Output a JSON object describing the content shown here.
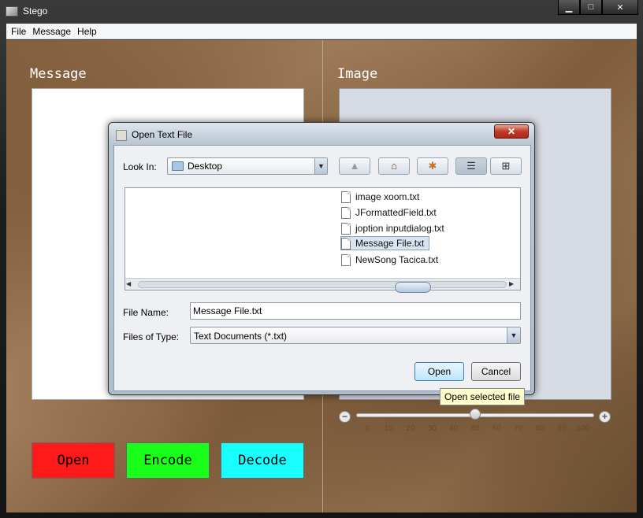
{
  "window": {
    "title": "Stego",
    "controls": {
      "minimize": "▁",
      "maximize": "□",
      "close": "✕"
    }
  },
  "menu": [
    "File",
    "Message",
    "Help"
  ],
  "panels": {
    "message_title": "Message",
    "image_title": "Image"
  },
  "buttons": {
    "open": "Open",
    "encode": "Encode",
    "decode": "Decode"
  },
  "button_colors": {
    "open": "#ff1a1a",
    "encode": "#1aff1a",
    "decode": "#19ffff"
  },
  "zoom": {
    "minus": "−",
    "plus": "+",
    "value_percent": 50,
    "ticks": [
      "0",
      "10",
      "20",
      "30",
      "40",
      "50",
      "60",
      "70",
      "80",
      "90",
      "100"
    ]
  },
  "tooltip": "Open selected file",
  "dialog": {
    "title": "Open Text File",
    "close": "✕",
    "look_in_label": "Look In:",
    "look_in_value": "Desktop",
    "toolbar_icons": [
      "up-folder-icon",
      "home-icon",
      "new-folder-icon",
      "list-view-icon",
      "details-view-icon"
    ],
    "files": [
      {
        "name": "image xoom.txt",
        "selected": false
      },
      {
        "name": "JFormattedField.txt",
        "selected": false
      },
      {
        "name": "joption inputdialog.txt",
        "selected": false
      },
      {
        "name": "Message File.txt",
        "selected": true
      },
      {
        "name": "NewSong Tacica.txt",
        "selected": false
      }
    ],
    "file_name_label": "File Name:",
    "file_name_value": "Message File.txt",
    "files_of_type_label": "Files of Type:",
    "files_of_type_value": "Text Documents (*.txt)",
    "open_button": "Open",
    "cancel_button": "Cancel"
  }
}
